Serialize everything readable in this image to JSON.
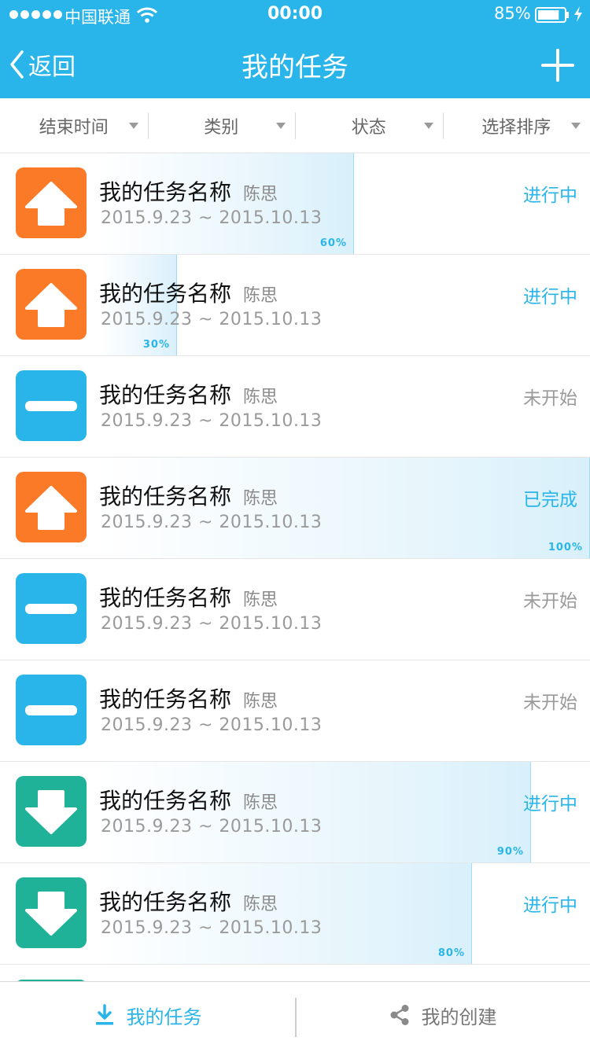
{
  "statusbar": {
    "carrier": "中国联通",
    "time": "00:00",
    "battery": "85%",
    "battery_level": 0.85
  },
  "nav": {
    "back_label": "返回",
    "title": "我的任务"
  },
  "filters": [
    "结束时间",
    "类别",
    "状态",
    "选择排序"
  ],
  "tasks": [
    {
      "name": "我的任务名称",
      "owner": "陈思",
      "date": "2015.9.23 ~ 2015.10.13",
      "status": "进行中",
      "progress": 60,
      "progress_label": "60%",
      "icon": "arrow-up-icon",
      "icon_color": "#fb7a27"
    },
    {
      "name": "我的任务名称",
      "owner": "陈思",
      "date": "2015.9.23 ~ 2015.10.13",
      "status": "进行中",
      "progress": 30,
      "progress_label": "30%",
      "icon": "arrow-up-icon",
      "icon_color": "#fb7a27"
    },
    {
      "name": "我的任务名称",
      "owner": "陈思",
      "date": "2015.9.23 ~ 2015.10.13",
      "status": "未开始",
      "progress": 0,
      "icon": "minus-icon",
      "icon_color": "#29b5ea"
    },
    {
      "name": "我的任务名称",
      "owner": "陈思",
      "date": "2015.9.23 ~ 2015.10.13",
      "status": "已完成",
      "progress": 100,
      "progress_label": "100%",
      "icon": "arrow-up-icon",
      "icon_color": "#fb7a27"
    },
    {
      "name": "我的任务名称",
      "owner": "陈思",
      "date": "2015.9.23 ~ 2015.10.13",
      "status": "未开始",
      "progress": 0,
      "icon": "minus-icon",
      "icon_color": "#29b5ea"
    },
    {
      "name": "我的任务名称",
      "owner": "陈思",
      "date": "2015.9.23 ~ 2015.10.13",
      "status": "未开始",
      "progress": 0,
      "icon": "minus-icon",
      "icon_color": "#29b5ea"
    },
    {
      "name": "我的任务名称",
      "owner": "陈思",
      "date": "2015.9.23 ~ 2015.10.13",
      "status": "进行中",
      "progress": 90,
      "progress_label": "90%",
      "icon": "arrow-down-icon",
      "icon_color": "#20b199"
    },
    {
      "name": "我的任务名称",
      "owner": "陈思",
      "date": "2015.9.23 ~ 2015.10.13",
      "status": "进行中",
      "progress": 80,
      "progress_label": "80%",
      "icon": "arrow-down-icon",
      "icon_color": "#20b199"
    }
  ],
  "tabbar": {
    "tab1": "我的任务",
    "tab2": "我的创建"
  },
  "colors": {
    "accent": "#29b5ea",
    "orange": "#fb7a27",
    "green": "#20b199"
  }
}
